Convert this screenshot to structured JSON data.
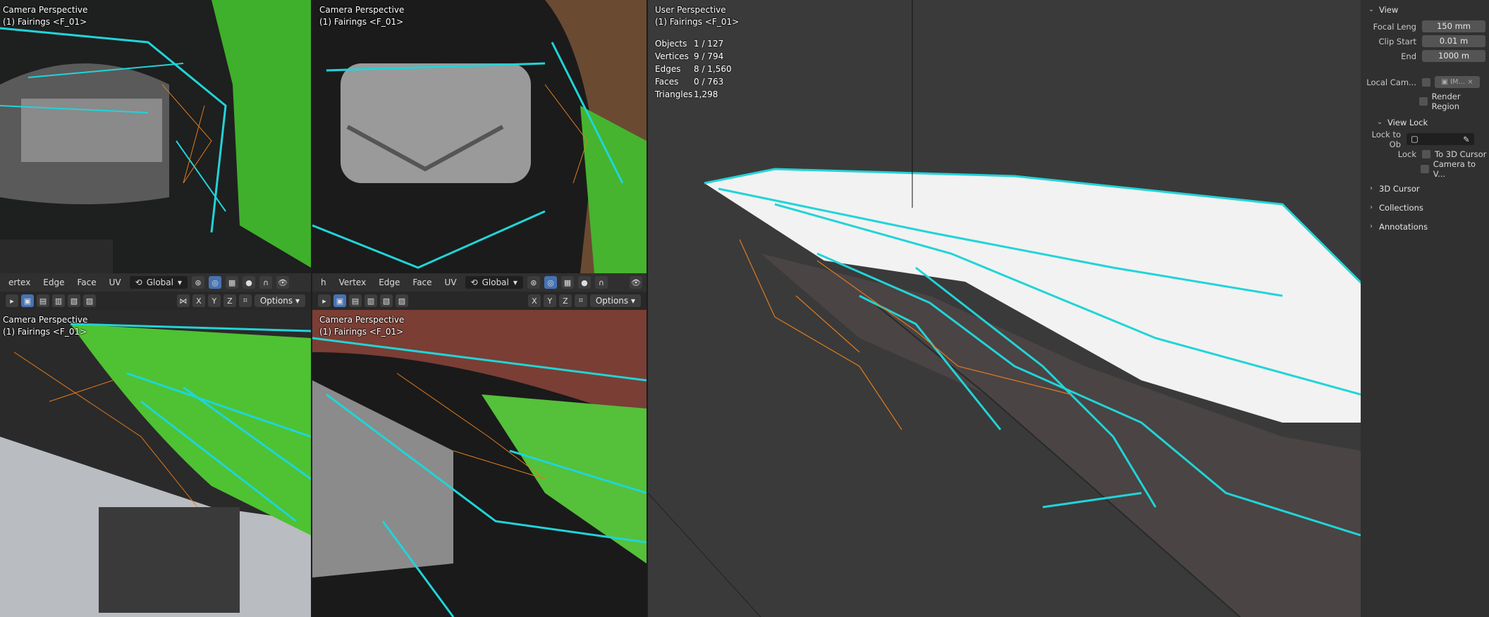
{
  "viewports": {
    "top_left": {
      "view_name": "Camera Perspective",
      "object_label": "(1) Fairings <F_01>"
    },
    "top_mid": {
      "view_name": "Camera Perspective",
      "object_label": "(1) Fairings <F_01>"
    },
    "bottom_left": {
      "view_name": "Camera Perspective",
      "object_label": "(1) Fairings <F_01>"
    },
    "bottom_mid": {
      "view_name": "Camera Perspective",
      "object_label": "(1) Fairings <F_01>"
    },
    "main": {
      "view_name": "User Perspective",
      "object_label": "(1) Fairings <F_01>"
    }
  },
  "header_left": {
    "menu": [
      "ertex",
      "Edge",
      "Face",
      "UV"
    ],
    "orientation": "Global"
  },
  "header_mid": {
    "menu": [
      "h",
      "Vertex",
      "Edge",
      "Face",
      "UV"
    ],
    "orientation": "Global"
  },
  "toolbar": {
    "options_label": "Options",
    "axes": [
      "X",
      "Y",
      "Z"
    ]
  },
  "stats": [
    {
      "label": "Objects",
      "value": "1 / 127"
    },
    {
      "label": "Vertices",
      "value": "9 / 794"
    },
    {
      "label": "Edges",
      "value": "8 / 1,560"
    },
    {
      "label": "Faces",
      "value": "0 / 763"
    },
    {
      "label": "Triangles",
      "value": "1,298"
    }
  ],
  "npanel": {
    "view_header": "View",
    "focal_label": "Focal Leng",
    "focal_value": "150 mm",
    "clip_start_label": "Clip Start",
    "clip_start_value": "0.01 m",
    "end_label": "End",
    "end_value": "1000 m",
    "local_camera_label": "Local Cam...",
    "local_camera_value": "IM...",
    "render_region_label": "Render Region",
    "view_lock_header": "View Lock",
    "lock_to_ob_label": "Lock to Ob",
    "lock_label": "Lock",
    "to_3d_cursor_label": "To 3D Cursor",
    "camera_to_view_label": "Camera to V...",
    "sections": [
      "3D Cursor",
      "Collections",
      "Annotations"
    ]
  },
  "colors": {
    "accent": "#4772b3",
    "edge_select": "#21d4d8",
    "vertex": "#000000",
    "bg": "#2b2b2b",
    "wire_orange": "#e07b1c"
  }
}
